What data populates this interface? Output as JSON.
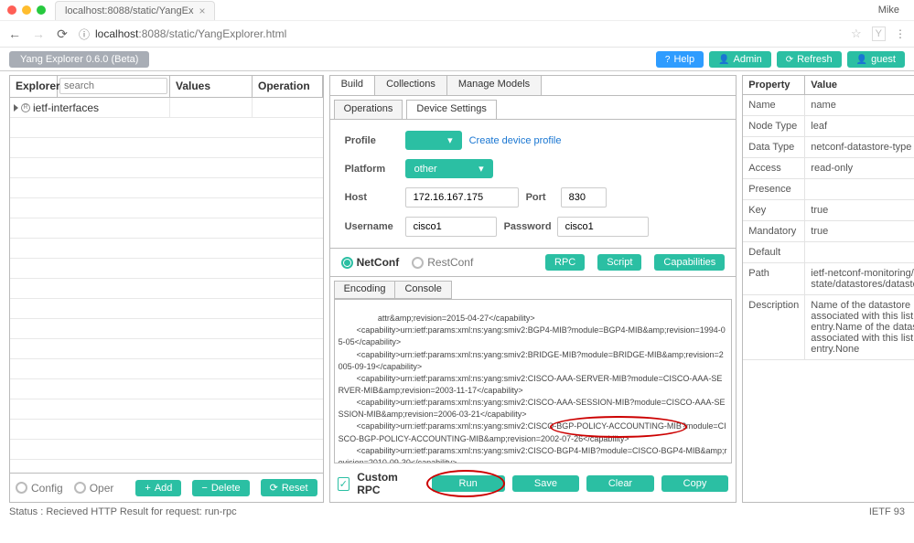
{
  "browser": {
    "tab_title": "localhost:8088/static/YangEx",
    "user": "Mike",
    "url_info_icon": "ⓘ",
    "url_host": "localhost",
    "url_port_path": ":8088/static/YangExplorer.html",
    "y_icon": "Y"
  },
  "app": {
    "version": "Yang Explorer 0.6.0 (Beta)",
    "help": "Help",
    "admin": "Admin",
    "refresh": "Refresh",
    "guest": "guest"
  },
  "explorer": {
    "col_explorer": "Explorer",
    "search_placeholder": "search",
    "col_values": "Values",
    "col_operation": "Operation",
    "rows": [
      {
        "label": "ietf-interfaces"
      }
    ],
    "footer": {
      "config": "Config",
      "oper": "Oper",
      "add": "Add",
      "delete": "Delete",
      "reset": "Reset"
    }
  },
  "mid": {
    "tabs1": {
      "build": "Build",
      "collections": "Collections",
      "manage": "Manage Models"
    },
    "tabs2": {
      "operations": "Operations",
      "device": "Device Settings"
    },
    "form": {
      "profile_label": "Profile",
      "create_profile": "Create device profile",
      "platform_label": "Platform",
      "platform_value": "other",
      "host_label": "Host",
      "host_value": "172.16.167.175",
      "port_label": "Port",
      "port_value": "830",
      "username_label": "Username",
      "username_value": "cisco1",
      "password_label": "Password",
      "password_value": "cisco1"
    },
    "proto": {
      "netconf": "NetConf",
      "restconf": "RestConf",
      "rpc": "RPC",
      "script": "Script",
      "caps": "Capabilities"
    },
    "tabs3": {
      "encoding": "Encoding",
      "console": "Console"
    },
    "console_text": "attr&amp;revision=2015-04-27</capability>\n        <capability>urn:ietf:params:xml:ns:yang:smiv2:BGP4-MIB?module=BGP4-MIB&amp;revision=1994-05-05</capability>\n        <capability>urn:ietf:params:xml:ns:yang:smiv2:BRIDGE-MIB?module=BRIDGE-MIB&amp;revision=2005-09-19</capability>\n        <capability>urn:ietf:params:xml:ns:yang:smiv2:CISCO-AAA-SERVER-MIB?module=CISCO-AAA-SERVER-MIB&amp;revision=2003-11-17</capability>\n        <capability>urn:ietf:params:xml:ns:yang:smiv2:CISCO-AAA-SESSION-MIB?module=CISCO-AAA-SESSION-MIB&amp;revision=2006-03-21</capability>\n        <capability>urn:ietf:params:xml:ns:yang:smiv2:CISCO-BGP-POLICY-ACCOUNTING-MIB?module=CISCO-BGP-POLICY-ACCOUNTING-MIB&amp;revision=2002-07-26</capability>\n        <capability>urn:ietf:params:xml:ns:yang:smiv2:CISCO-BGP4-MIB?module=CISCO-BGP4-MIB&amp;revision=2010-09-30</capability>\n        <capability>urn:ietf:params:xml:ns:yang:smiv2:CISCO-BULK-FILE-MIB?module=CISCO-BULK-FILE-MIB&amp;revision=2002-06-10</capability>\n        <capability>urn:ietf:params:xml:ns:yang:smiv2:CISCO-CBP-TARGET-MIB?module=CISCO-CBP-TARGET-MIB&amp;revision=2006-05-24</capability>",
    "bottom": {
      "custom_rpc": "Custom RPC",
      "run": "Run",
      "save": "Save",
      "clear": "Clear",
      "copy": "Copy"
    }
  },
  "props": {
    "header": {
      "prop": "Property",
      "val": "Value"
    },
    "rows": [
      {
        "k": "Name",
        "v": "name"
      },
      {
        "k": "Node Type",
        "v": "leaf"
      },
      {
        "k": "Data Type",
        "v": "netconf-datastore-type"
      },
      {
        "k": "Access",
        "v": "read-only"
      },
      {
        "k": "Presence",
        "v": ""
      },
      {
        "k": "Key",
        "v": "true"
      },
      {
        "k": "Mandatory",
        "v": "true"
      },
      {
        "k": "Default",
        "v": ""
      },
      {
        "k": "Path",
        "v": "ietf-netconf-monitoring/netconf-state/datastores/datastore/name"
      },
      {
        "k": "Description",
        "v": "Name of the datastore associated with this list entry.Name of the datastore associated with this list entry.None"
      }
    ]
  },
  "status": {
    "left": "Status : Recieved HTTP Result for request: run-rpc",
    "right": "IETF 93"
  }
}
